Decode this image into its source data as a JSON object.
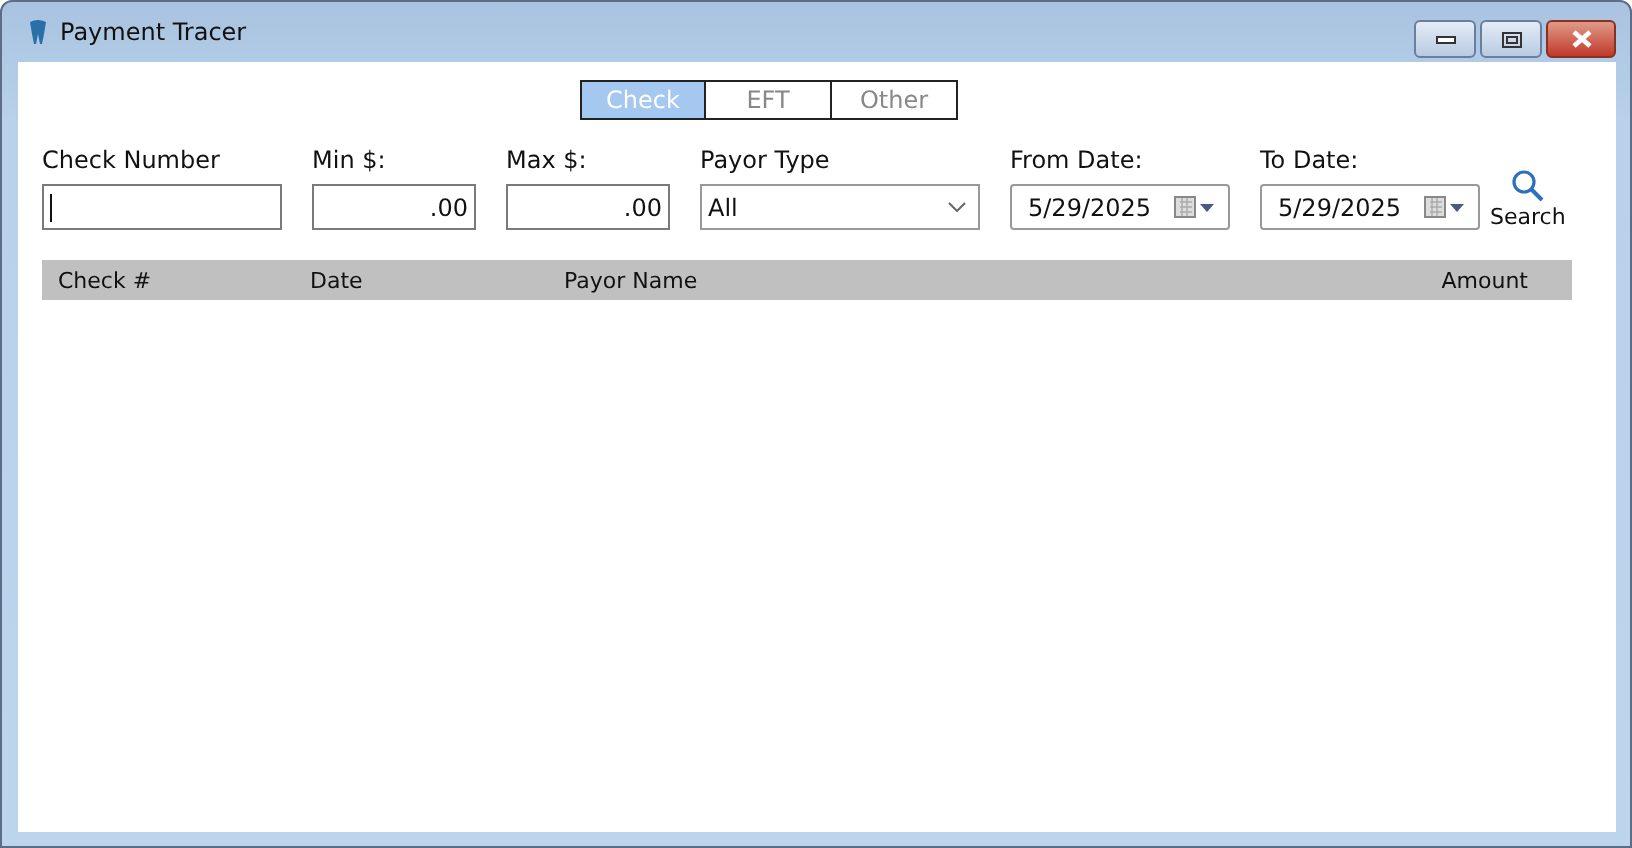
{
  "window": {
    "title": "Payment Tracer"
  },
  "tabs": [
    {
      "label": "Check",
      "selected": true
    },
    {
      "label": "EFT",
      "selected": false
    },
    {
      "label": "Other",
      "selected": false
    }
  ],
  "filters": {
    "check_number": {
      "label": "Check Number"
    },
    "min": {
      "label": "Min $:",
      "value": ".00"
    },
    "max": {
      "label": "Max $:",
      "value": ".00"
    },
    "payor_type": {
      "label": "Payor Type",
      "value": "All"
    },
    "from_date": {
      "label": "From Date:",
      "value": "5/29/2025"
    },
    "to_date": {
      "label": "To Date:",
      "value": "5/29/2025"
    },
    "search": "Search"
  },
  "table": {
    "columns": [
      "Check #",
      "Date",
      "Payor Name",
      "Amount"
    ]
  }
}
